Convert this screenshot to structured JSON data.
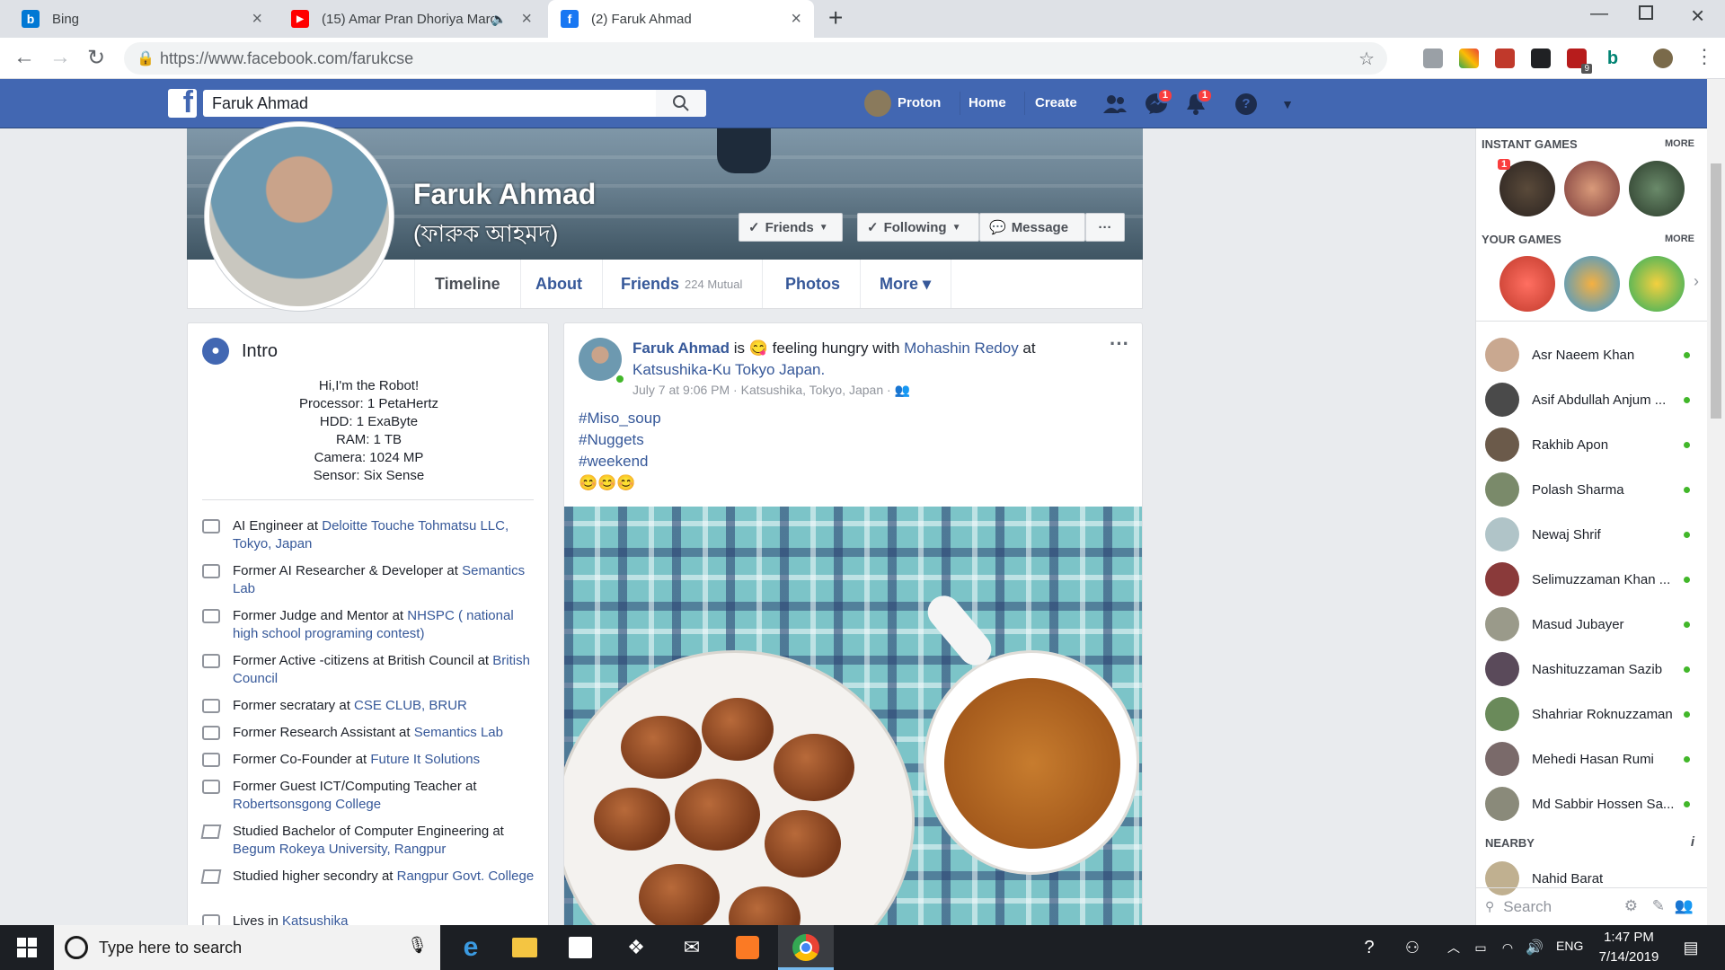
{
  "browser": {
    "tabs": [
      {
        "title": "Bing",
        "icon": "bing-icon"
      },
      {
        "title": "(15) Amar Pran Dhoriya Marc",
        "icon": "youtube-icon"
      },
      {
        "title": "(2) Faruk Ahmad",
        "icon": "facebook-icon"
      }
    ],
    "new_tab": "+",
    "url": "https://www.facebook.com/farukcse",
    "ext_badge": "9"
  },
  "fb": {
    "logo": "f",
    "search_value": "Faruk Ahmad",
    "nav": {
      "profile": "Proton",
      "home": "Home",
      "create": "Create"
    },
    "messenger_badge": "1",
    "notif_badge": "1",
    "help": "?"
  },
  "profile": {
    "name": "Faruk Ahmad",
    "name_bn": "(ফারুক আহমদ)",
    "buttons": {
      "friends": "Friends",
      "following": "Following",
      "message": "Message",
      "more": "···"
    },
    "tabs": {
      "timeline": "Timeline",
      "about": "About",
      "friends": "Friends",
      "friends_count": "224 Mutual",
      "photos": "Photos",
      "more": "More ▾"
    }
  },
  "intro": {
    "title": "Intro",
    "bio": [
      "Hi,I'm the Robot!",
      "Processor: 1 PetaHertz",
      "HDD: 1 ExaByte",
      "RAM: 1 TB",
      "Camera: 1024 MP",
      "Sensor: Six Sense"
    ],
    "items": [
      {
        "pre": "AI Engineer at ",
        "link": "Deloitte Touche Tohmatsu LLC, Tokyo, Japan",
        "icon": "briefcase-icon"
      },
      {
        "pre": "Former AI Researcher & Developer at ",
        "link": "Semantics Lab",
        "icon": "briefcase-icon"
      },
      {
        "pre": "Former Judge and Mentor at ",
        "link": "NHSPC ( national high school programing contest)",
        "icon": "briefcase-icon"
      },
      {
        "pre": "Former Active -citizens at British Council at ",
        "link": "British Council",
        "icon": "briefcase-icon"
      },
      {
        "pre": "Former secratary at ",
        "link": "CSE CLUB, BRUR",
        "icon": "briefcase-icon"
      },
      {
        "pre": "Former Research Assistant at ",
        "link": "Semantics Lab",
        "icon": "briefcase-icon"
      },
      {
        "pre": "Former Co-Founder at ",
        "link": "Future It Solutions",
        "icon": "briefcase-icon"
      },
      {
        "pre": "Former Guest ICT/Computing Teacher at ",
        "link": "Robertsonsgong College",
        "icon": "briefcase-icon"
      },
      {
        "pre": "Studied Bachelor of Computer Engineering at ",
        "link": "Begum Rokeya University, Rangpur",
        "icon": "graduation-cap-icon"
      },
      {
        "pre": "Studied higher secondry at ",
        "link": "Rangpur Govt. College",
        "icon": "graduation-cap-icon"
      },
      {
        "pre": "Lives in ",
        "link": "Katsushika",
        "icon": "home-icon"
      }
    ]
  },
  "post": {
    "author": "Faruk Ahmad",
    "is": " is ",
    "emoji": "😋",
    "feeling": " feeling hungry with ",
    "with": "Mohashin Redoy",
    "at": " at ",
    "place": "Katsushika-Ku Tokyo Japan.",
    "time": "July 7 at 9:06 PM",
    "location": "Katsushika, Tokyo, Japan",
    "more": "···",
    "tags": [
      "#Miso_soup",
      "#Nuggets",
      "#weekend"
    ],
    "emojis": "😊😊😊"
  },
  "sidebar": {
    "instant_games": "INSTANT GAMES",
    "your_games": "YOUR GAMES",
    "more": "MORE",
    "game_badge": "1",
    "contacts": [
      "Asr Naeem Khan",
      "Asif Abdullah Anjum ...",
      "Rakhib Apon",
      "Polash Sharma",
      "Newaj Shrif",
      "Selimuzzaman Khan ...",
      "Masud Jubayer",
      "Nashituzzaman Sazib",
      "Shahriar Roknuzzaman",
      "Mehedi Hasan Rumi",
      "Md Sabbir Hossen Sa..."
    ],
    "nearby": "NEARBY",
    "nearby_contact": "Nahid Barat",
    "search_placeholder": "Search"
  },
  "taskbar": {
    "search_placeholder": "Type here to search",
    "lang": "ENG",
    "time": "1:47 PM",
    "date": "7/14/2019"
  }
}
